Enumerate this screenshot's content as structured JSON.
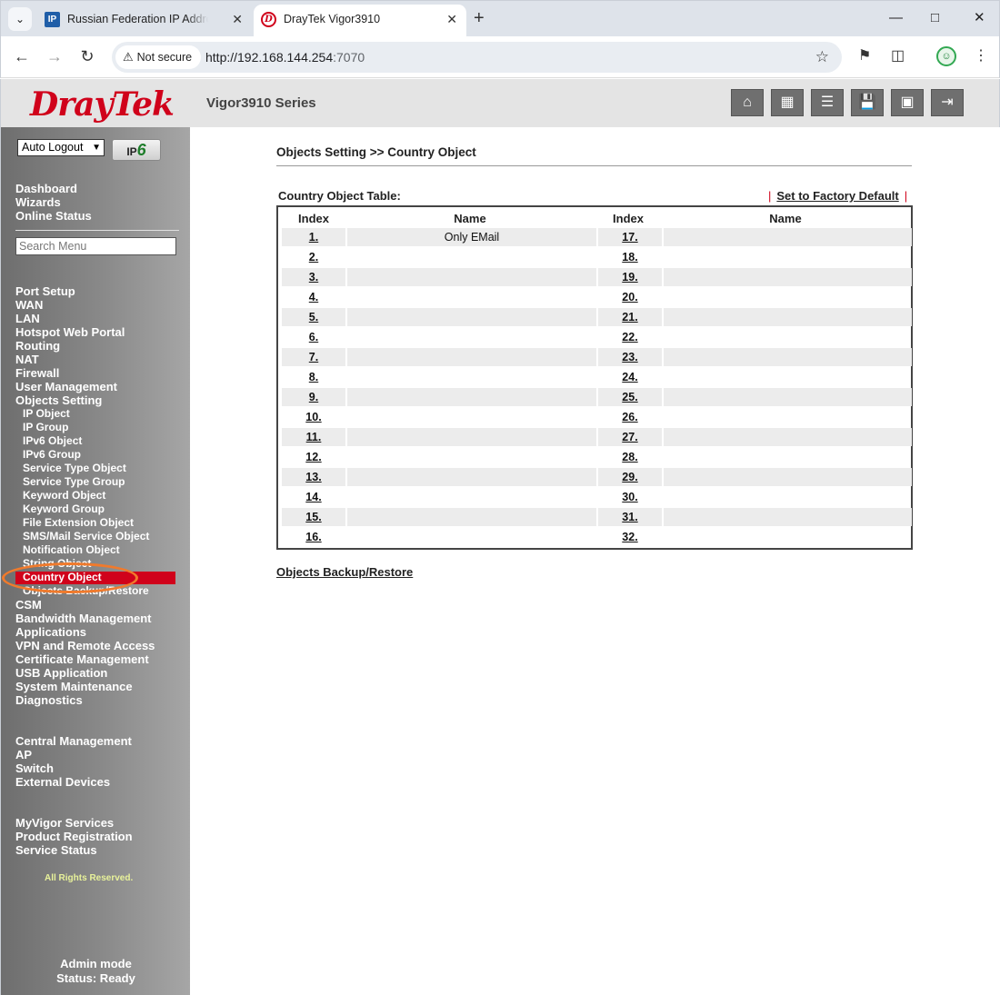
{
  "browser": {
    "tabs": [
      {
        "fav": "IP",
        "title": "Russian Federation IP Address Ranges",
        "active": false
      },
      {
        "fav": "D",
        "title": "DrayTek Vigor3910",
        "active": true
      }
    ],
    "security_label": "Not secure",
    "url_host": "http://192.168.144.254",
    "url_port": ":7070"
  },
  "header": {
    "logo_text": "DrayTek",
    "series": "Vigor3910 Series",
    "buttons": [
      "home-icon",
      "layout-icon",
      "sliders-icon",
      "save-icon",
      "contact-icon",
      "logout-icon"
    ]
  },
  "sidebar": {
    "auto_logout": "Auto Logout",
    "ipv6_label": "IP",
    "ipv6_six": "6",
    "top_items": [
      "Dashboard",
      "Wizards",
      "Online Status"
    ],
    "search_placeholder": "Search Menu",
    "items": [
      "Port Setup",
      "WAN",
      "LAN",
      "Hotspot Web Portal",
      "Routing",
      "NAT",
      "Firewall",
      "User Management",
      "Objects Setting"
    ],
    "sub_items": [
      "IP Object",
      "IP Group",
      "IPv6 Object",
      "IPv6 Group",
      "Service Type Object",
      "Service Type Group",
      "Keyword Object",
      "Keyword Group",
      "File Extension Object",
      "SMS/Mail Service Object",
      "Notification Object",
      "String Object",
      "Country Object",
      "Objects Backup/Restore"
    ],
    "active_sub": "Country Object",
    "after_items": [
      "CSM",
      "Bandwidth Management",
      "Applications",
      "VPN and Remote Access",
      "Certificate Management",
      "USB Application",
      "System Maintenance",
      "Diagnostics"
    ],
    "central_items": [
      "Central Management",
      "AP",
      "Switch",
      "External Devices"
    ],
    "myvigor_items": [
      "MyVigor Services",
      "Product Registration",
      "Service Status"
    ],
    "rights": "All Rights Reserved.",
    "mode": "Admin mode",
    "status": "Status: Ready"
  },
  "main": {
    "breadcrumb": "Objects Setting >> Country Object",
    "table_title": "Country Object Table:",
    "factory_default": "Set to Factory Default",
    "headers": {
      "index": "Index",
      "name": "Name"
    },
    "rows": [
      {
        "left_index": "1.",
        "left_name": "Only EMail",
        "right_index": "17.",
        "right_name": ""
      },
      {
        "left_index": "2.",
        "left_name": "",
        "right_index": "18.",
        "right_name": ""
      },
      {
        "left_index": "3.",
        "left_name": "",
        "right_index": "19.",
        "right_name": ""
      },
      {
        "left_index": "4.",
        "left_name": "",
        "right_index": "20.",
        "right_name": ""
      },
      {
        "left_index": "5.",
        "left_name": "",
        "right_index": "21.",
        "right_name": ""
      },
      {
        "left_index": "6.",
        "left_name": "",
        "right_index": "22.",
        "right_name": ""
      },
      {
        "left_index": "7.",
        "left_name": "",
        "right_index": "23.",
        "right_name": ""
      },
      {
        "left_index": "8.",
        "left_name": "",
        "right_index": "24.",
        "right_name": ""
      },
      {
        "left_index": "9.",
        "left_name": "",
        "right_index": "25.",
        "right_name": ""
      },
      {
        "left_index": "10.",
        "left_name": "",
        "right_index": "26.",
        "right_name": ""
      },
      {
        "left_index": "11.",
        "left_name": "",
        "right_index": "27.",
        "right_name": ""
      },
      {
        "left_index": "12.",
        "left_name": "",
        "right_index": "28.",
        "right_name": ""
      },
      {
        "left_index": "13.",
        "left_name": "",
        "right_index": "29.",
        "right_name": ""
      },
      {
        "left_index": "14.",
        "left_name": "",
        "right_index": "30.",
        "right_name": ""
      },
      {
        "left_index": "15.",
        "left_name": "",
        "right_index": "31.",
        "right_name": ""
      },
      {
        "left_index": "16.",
        "left_name": "",
        "right_index": "32.",
        "right_name": ""
      }
    ],
    "backup_link": "Objects Backup/Restore"
  },
  "colors": {
    "brand_red": "#d0021b",
    "callout": "#f07a2c"
  }
}
